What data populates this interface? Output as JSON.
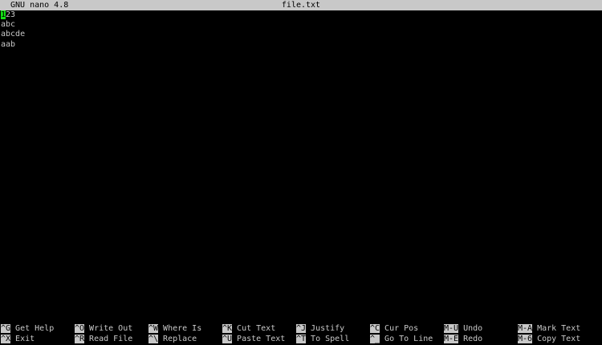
{
  "titlebar": {
    "app": "GNU nano 4.8",
    "filename": "file.txt"
  },
  "editor": {
    "cursor_char": "1",
    "lines": [
      "23",
      "abc",
      "abcde",
      "aab"
    ]
  },
  "shortcuts": [
    {
      "key": "^G",
      "label": "Get Help"
    },
    {
      "key": "^X",
      "label": "Exit"
    },
    {
      "key": "^O",
      "label": "Write Out"
    },
    {
      "key": "^R",
      "label": "Read File"
    },
    {
      "key": "^W",
      "label": "Where Is"
    },
    {
      "key": "^\\",
      "label": "Replace"
    },
    {
      "key": "^K",
      "label": "Cut Text"
    },
    {
      "key": "^U",
      "label": "Paste Text"
    },
    {
      "key": "^J",
      "label": "Justify"
    },
    {
      "key": "^T",
      "label": "To Spell"
    },
    {
      "key": "^C",
      "label": "Cur Pos"
    },
    {
      "key": "^_",
      "label": "Go To Line"
    },
    {
      "key": "M-U",
      "label": "Undo"
    },
    {
      "key": "M-E",
      "label": "Redo"
    },
    {
      "key": "M-A",
      "label": "Mark Text"
    },
    {
      "key": "M-6",
      "label": "Copy Text"
    }
  ],
  "colors": {
    "background": "#000000",
    "foreground": "#c8c8c8",
    "cursor": "#13e013"
  }
}
